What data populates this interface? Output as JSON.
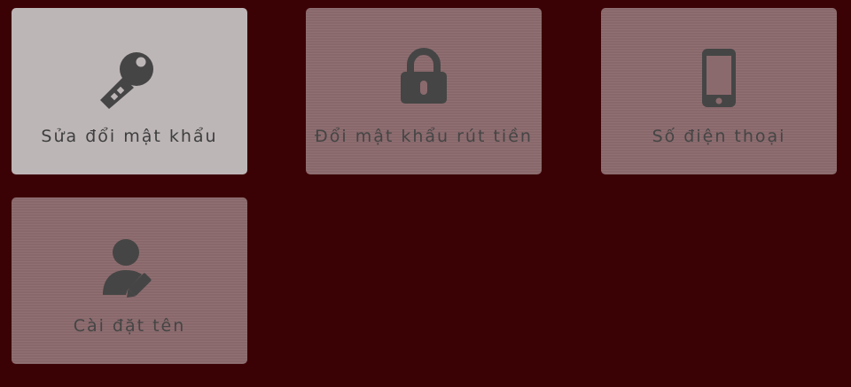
{
  "colors": {
    "background": "#3b0205",
    "card": "#8b6a6d",
    "card_active": "#bdb6b7",
    "icon": "#454545",
    "text": "#454545"
  },
  "menu": {
    "items": [
      {
        "label": "Sửa đổi mật khẩu",
        "icon": "key-icon",
        "active": true
      },
      {
        "label": "Đổi mật khẩu rút tiền",
        "icon": "lock-icon",
        "active": false
      },
      {
        "label": "Số điện thoại",
        "icon": "phone-icon",
        "active": false
      },
      {
        "label": "Cài đặt tên",
        "icon": "user-edit-icon",
        "active": false
      }
    ]
  }
}
